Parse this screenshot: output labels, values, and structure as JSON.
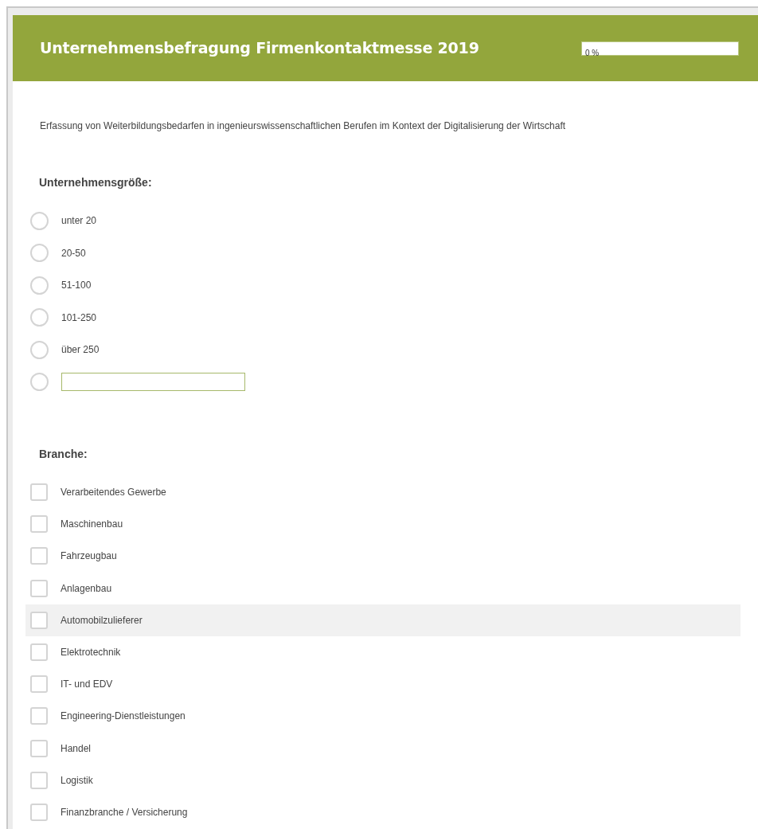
{
  "header": {
    "title": "Unternehmensbefragung Firmenkontaktmesse 2019",
    "progress": {
      "label": "0 %",
      "level": 0
    }
  },
  "description": "Erfassung von Weiterbildungsbedarfen in ingenieurswissenschaftlichen Berufen im Kontext der Digitalisierung der Wirtschaft",
  "questions": [
    {
      "kind": "radio",
      "title": "Unternehmensgröße:",
      "options": [
        {
          "kind": "option",
          "label": "unter 20",
          "selected": false
        },
        {
          "kind": "option",
          "label": "20-50",
          "selected": false
        },
        {
          "kind": "option",
          "label": "51-100",
          "selected": false
        },
        {
          "kind": "option",
          "label": "101-250",
          "selected": false
        },
        {
          "kind": "option",
          "label": "über 250",
          "selected": false
        },
        {
          "kind": "other",
          "selected": false
        }
      ]
    },
    {
      "kind": "checkbox",
      "title": "Branche:",
      "options": [
        {
          "label": "Verarbeitendes Gewerbe",
          "checked": false,
          "highlighted": false
        },
        {
          "label": "Maschinenbau",
          "checked": false,
          "highlighted": false
        },
        {
          "label": "Fahrzeugbau",
          "checked": false,
          "highlighted": false
        },
        {
          "label": "Anlagenbau",
          "checked": false,
          "highlighted": false
        },
        {
          "label": "Automobilzulieferer",
          "checked": false,
          "highlighted": true
        },
        {
          "label": "Elektrotechnik",
          "checked": false,
          "highlighted": false
        },
        {
          "label": "IT- und EDV",
          "checked": false,
          "highlighted": false
        },
        {
          "label": "Engineering-Dienstleistungen",
          "checked": false,
          "highlighted": false
        },
        {
          "label": "Handel",
          "checked": false,
          "highlighted": false
        },
        {
          "label": "Logistik",
          "checked": false,
          "highlighted": false
        },
        {
          "label": "Finanzbranche / Versicherung",
          "checked": false,
          "highlighted": false
        }
      ]
    }
  ]
}
